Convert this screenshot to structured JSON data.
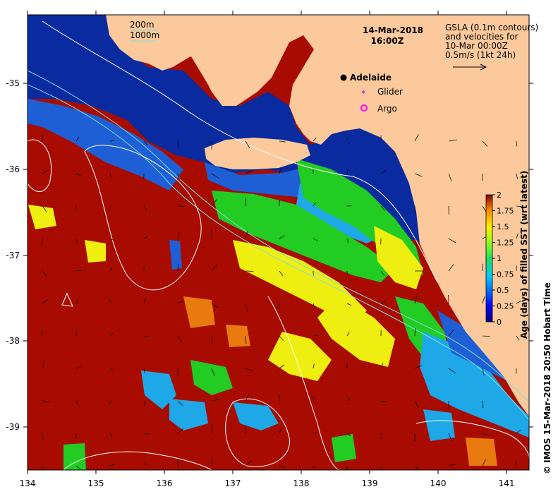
{
  "map": {
    "date_line1": "14-Mar-2018",
    "date_line2": "16:00Z",
    "legend_depth": [
      "200m",
      "1000m"
    ],
    "gsla_note": [
      "GSLA (0.1m contours)",
      "and velocities for",
      "10-Mar 00:00Z",
      "0.5m/s (1kt 24h)"
    ],
    "city": "Adelaide",
    "glider_label": "Glider",
    "argo_label": "Argo",
    "credit": "© IMOS 15-Mar-2018 20:50 Hobart Time",
    "xticks": [
      "134",
      "135",
      "136",
      "137",
      "138",
      "139",
      "140",
      "141"
    ],
    "yticks": [
      "-35",
      "-36",
      "-37",
      "-38",
      "-39"
    ],
    "colorbar": {
      "title": "Age (days) of filled SST (wrt latest)",
      "ticks": [
        "2",
        "1.75",
        "1.5",
        "1.25",
        "1",
        "0.75",
        "0.5",
        "0.25",
        "0"
      ]
    },
    "colors": {
      "land": "#fbc99b",
      "deep_blue": "#0a2aa0",
      "mid_blue": "#1e5fd6",
      "cyan": "#1ea8e8",
      "green": "#22cc22",
      "yellow": "#eeee10",
      "orange": "#e87a10",
      "dark_red": "#a80c00"
    }
  }
}
